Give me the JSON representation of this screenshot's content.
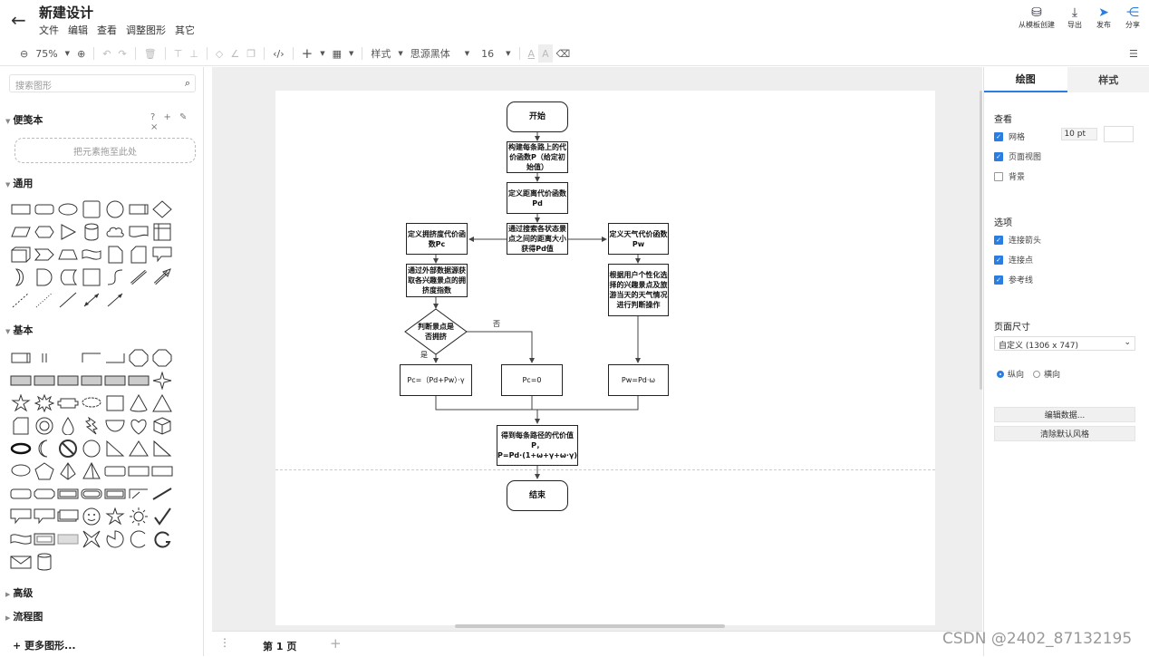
{
  "header": {
    "back_icon": "←",
    "title": "新建设计",
    "menu": [
      "文件",
      "编辑",
      "查看",
      "调整图形",
      "其它"
    ],
    "actions": [
      {
        "label": "从模板创建",
        "icon": "template-icon"
      },
      {
        "label": "导出",
        "icon": "export-icon"
      },
      {
        "label": "发布",
        "icon": "publish-icon"
      },
      {
        "label": "分享",
        "icon": "share-icon"
      }
    ]
  },
  "toolbar": {
    "zoom": "75%",
    "style_menu": "样式",
    "font_family": "思源黑体",
    "font_size": "16"
  },
  "left_panel": {
    "search_placeholder": "搜索图形",
    "scratchpad": {
      "title": "便笺本",
      "tools": "? + ✎ ×",
      "drop_hint": "把元素拖至此处"
    },
    "sections": {
      "general": "通用",
      "basic": "基本",
      "advanced": "高级",
      "flowchart": "流程图"
    },
    "more_shapes": "+ 更多图形..."
  },
  "diagram": {
    "nodes": {
      "start": "开始",
      "build": "构建每条路上的代价函数P（给定初始值）",
      "distance": "定义距离代价函数Pd",
      "search": "通过搜索各状态景点之间的距离大小获得Pd值",
      "crowd_def": "定义拥挤度代价函数Pc",
      "weather_def": "定义天气代价函数Pw",
      "crowd_data": "通过外部数据源获取各兴趣景点的拥挤度指数",
      "weather_judge": "根据用户个性化选择的兴趣景点及旅游当天的天气情况进行判断操作",
      "decision": "判断景点是否拥挤",
      "pc_formula": "Pc=（Pd+Pw）·γ",
      "pc_zero": "Pc=0",
      "pw_formula": "Pw=Pd·ω",
      "result": "得到每条路径的代价值P，P=Pd·(1+ω+γ+ω·γ)",
      "end": "结束"
    },
    "edge_labels": {
      "no": "否",
      "yes": "是"
    }
  },
  "bottom": {
    "page_tab": "第 1 页",
    "add_icon": "+"
  },
  "right_panel": {
    "tabs": [
      "绘图",
      "样式"
    ],
    "view_title": "查看",
    "view_options": [
      {
        "label": "网格",
        "checked": true
      },
      {
        "label": "页面视图",
        "checked": true
      },
      {
        "label": "背景",
        "checked": false
      }
    ],
    "grid_size": "10 pt",
    "options_title": "选项",
    "options": [
      {
        "label": "连接箭头",
        "checked": true
      },
      {
        "label": "连接点",
        "checked": true
      },
      {
        "label": "参考线",
        "checked": true
      }
    ],
    "page_size_title": "页面尺寸",
    "page_size_value": "自定义 (1306 x 747)",
    "orientation": [
      "纵向",
      "横向"
    ],
    "orientation_selected": "纵向",
    "buttons": [
      "编辑数据...",
      "清除默认风格"
    ]
  },
  "watermark": "CSDN @2402_87132195",
  "colors": {
    "accent": "#2a7de1",
    "canvas": "#eeeeee"
  }
}
